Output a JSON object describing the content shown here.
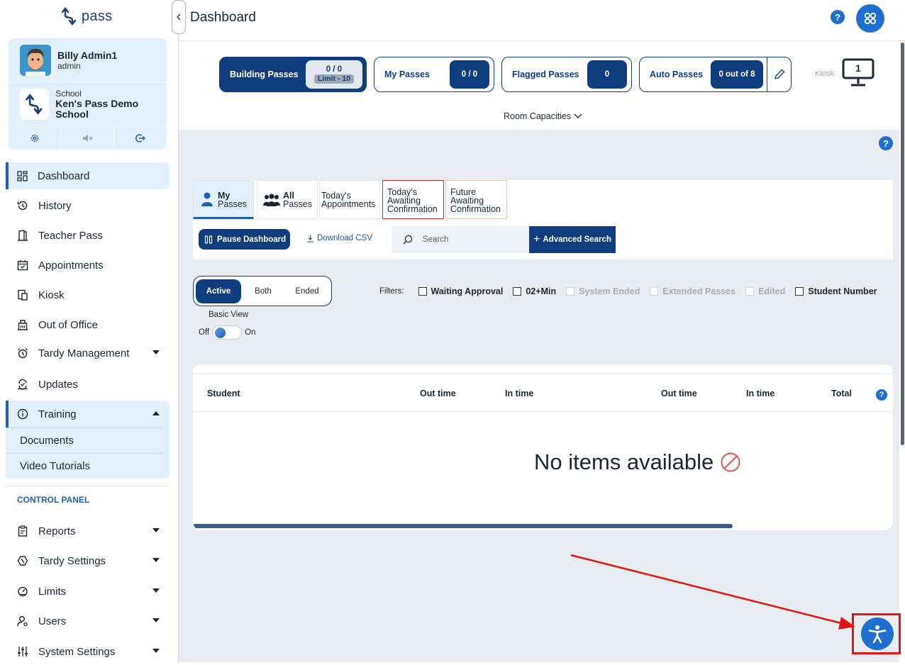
{
  "app": {
    "logo_text": "pass"
  },
  "user": {
    "name": "Billy Admin1",
    "role": "admin"
  },
  "school": {
    "label": "School",
    "name": "Ken's Pass Demo School"
  },
  "sidebar": {
    "items": [
      {
        "label": "Dashboard"
      },
      {
        "label": "History"
      },
      {
        "label": "Teacher Pass"
      },
      {
        "label": "Appointments"
      },
      {
        "label": "Kiosk"
      },
      {
        "label": "Out of Office"
      },
      {
        "label": "Tardy Management"
      },
      {
        "label": "Updates"
      },
      {
        "label": "Training"
      }
    ],
    "training_sub": [
      {
        "label": "Documents"
      },
      {
        "label": "Video Tutorials"
      }
    ],
    "control_panel_label": "CONTROL PANEL",
    "control_items": [
      {
        "label": "Reports"
      },
      {
        "label": "Tardy Settings"
      },
      {
        "label": "Limits"
      },
      {
        "label": "Users"
      },
      {
        "label": "System Settings"
      }
    ]
  },
  "header": {
    "title": "Dashboard",
    "help": "?"
  },
  "counters": {
    "building": {
      "label": "Building Passes",
      "value": "0 / 0",
      "limit": "Limit - 10"
    },
    "my": {
      "label": "My Passes",
      "value": "0 / 0"
    },
    "flagged": {
      "label": "Flagged Passes",
      "value": "0"
    },
    "auto": {
      "label": "Auto Passes",
      "value": "0 out of 8"
    },
    "kiosk_label": "Kiosk:",
    "kiosk_value": "1",
    "room_capacities": "Room Capacities"
  },
  "tabs": {
    "my_passes": {
      "line1": "My",
      "line2": "Passes"
    },
    "all_passes": {
      "line1": "All",
      "line2": "Passes"
    },
    "todays_appointments": {
      "line1": "Today's",
      "line2": "Appointments"
    },
    "todays_awaiting": {
      "line1": "Today's",
      "line2": "Awaiting",
      "line3": "Confirmation"
    },
    "future_awaiting": {
      "line1": "Future",
      "line2": "Awaiting",
      "line3": "Confirmation"
    }
  },
  "toolbar": {
    "pause": "Pause Dashboard",
    "download_csv": "Download CSV",
    "search_placeholder": "Search",
    "advanced_search": "Advanced Search"
  },
  "status": {
    "active": "Active",
    "both": "Both",
    "ended": "Ended"
  },
  "basic_view": {
    "label": "Basic View",
    "off": "Off",
    "on": "On"
  },
  "filters": {
    "label": "Filters:",
    "waiting_approval": "Waiting Approval",
    "min": "02+Min",
    "system_ended": "System Ended",
    "extended_passes": "Extended Passes",
    "edited": "Edited",
    "student_number": "Student Number"
  },
  "table": {
    "columns": [
      "Student",
      "Out time",
      "In time",
      "Out time",
      "In time",
      "Total"
    ],
    "empty_message": "No items available"
  },
  "colors": {
    "brand": "#0f3d7e",
    "accent": "#1f6fd1",
    "annotation": "#e01717"
  },
  "icons": {
    "a11y": "accessibility-icon",
    "apps": "apps-icon",
    "kiosk": "monitor-icon"
  }
}
